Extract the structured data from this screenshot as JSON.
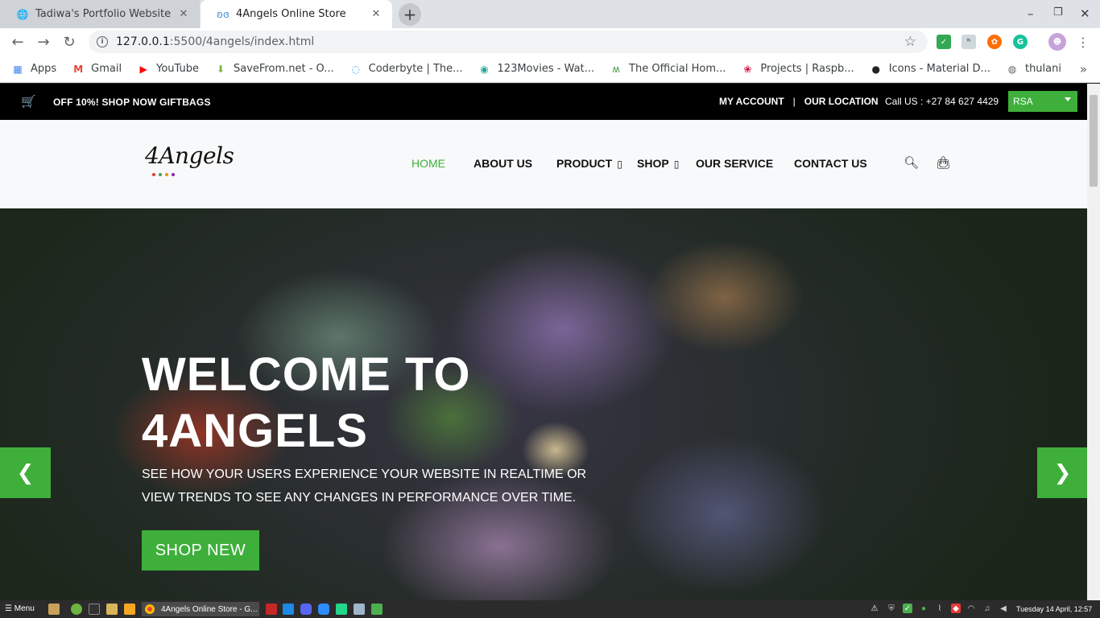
{
  "browser": {
    "tabs": [
      {
        "title": "Tadiwa's Portfolio Website",
        "active": false
      },
      {
        "title": "4Angels Online Store",
        "active": true
      }
    ],
    "url_host": "127.0.0.1",
    "url_path": ":5500/4angels/index.html",
    "bookmarks": [
      {
        "label": "Apps",
        "icon": "apps-grid-icon",
        "color": "#4285f4"
      },
      {
        "label": "Gmail",
        "icon": "gmail-icon",
        "color": "#ea4335"
      },
      {
        "label": "YouTube",
        "icon": "youtube-icon",
        "color": "#ff0000"
      },
      {
        "label": "SaveFrom.net - O...",
        "icon": "savefrom-icon",
        "color": "#7cb342"
      },
      {
        "label": "Coderbyte | The...",
        "icon": "coderbyte-icon",
        "color": "#2196f3"
      },
      {
        "label": "123Movies - Wat...",
        "icon": "movies-icon",
        "color": "#26a69a"
      },
      {
        "label": "The Official Hom...",
        "icon": "official-home-icon",
        "color": "#43a047"
      },
      {
        "label": "Projects | Raspb...",
        "icon": "raspberry-icon",
        "color": "#c51a4a"
      },
      {
        "label": "Icons - Material D...",
        "icon": "github-icon",
        "color": "#222222"
      },
      {
        "label": "thulani",
        "icon": "globe-icon",
        "color": "#5f6368"
      }
    ]
  },
  "site": {
    "topbar": {
      "promo": "OFF 10%! SHOP NOW GIFTBAGS",
      "my_account": "MY ACCOUNT",
      "separator": "|",
      "our_location": "OUR LOCATION",
      "phone": "Call US : +27 84 627 4429",
      "region": "RSA"
    },
    "logo": "4Angels",
    "nav": {
      "home": "HOME",
      "about": "ABOUT US",
      "product": "PRODUCT",
      "shop": "SHOP",
      "service": "OUR SERVICE",
      "contact": "CONTACT US",
      "dropdown_glyph": "▯"
    },
    "hero": {
      "title_line1": "WELCOME TO",
      "title_line2": "4ANGELS",
      "subtitle": "SEE HOW YOUR USERS EXPERIENCE YOUR WEBSITE IN REALTIME OR VIEW TRENDS TO SEE ANY CHANGES IN PERFORMANCE OVER TIME.",
      "cta": "SHOP NEW"
    },
    "colors": {
      "accent": "#3eaf3b",
      "topbar": "#000000",
      "header": "#f8f9fa"
    }
  },
  "taskbar": {
    "menu": "Menu",
    "active_task": "4Angels Online Store - G...",
    "clock": "Tuesday 14 April, 12:57"
  }
}
